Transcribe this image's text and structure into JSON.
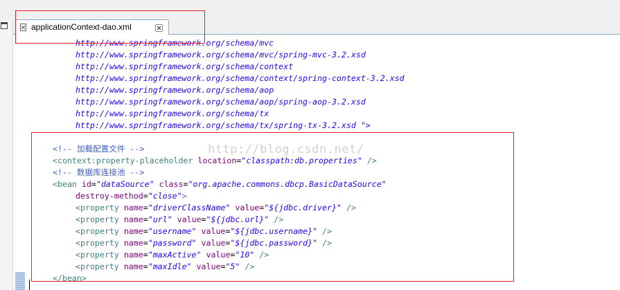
{
  "tab": {
    "label": "applicationContext-dao.xml"
  },
  "urls": [
    "http://www.springframework.org/schema/mvc",
    "http://www.springframework.org/schema/mvc/spring-mvc-3.2.xsd",
    "http://www.springframework.org/schema/context",
    "http://www.springframework.org/schema/context/spring-context-3.2.xsd",
    "http://www.springframework.org/schema/aop",
    "http://www.springframework.org/schema/aop/spring-aop-3.2.xsd",
    "http://www.springframework.org/schema/tx",
    "http://www.springframework.org/schema/tx/spring-tx-3.2.xsd"
  ],
  "url_end": " \">",
  "code": {
    "comment1": "<!-- 加载配置文件 -->",
    "placeholder_tag": "<context:property-placeholder",
    "placeholder_attr": "location",
    "placeholder_value": "\"classpath:db.properties\"",
    "placeholder_end": " />",
    "comment2": "<!-- 数据库连接池 -->",
    "bean_tag": "<bean",
    "bean_id_attr": "id",
    "bean_id_value": "\"dataSource\"",
    "bean_class_attr": "class",
    "bean_class_value": "\"org.apache.commons.dbcp.BasicDataSource\"",
    "destroy_attr": "destroy-method",
    "destroy_value": "\"close\"",
    "destroy_end": ">",
    "property_tag": "<property",
    "name_attr": "name",
    "value_attr": "value",
    "property_end": " />",
    "bean_close": "</bean>",
    "properties": [
      {
        "name": "\"driverClassName\"",
        "value": "\"${jdbc.driver}\""
      },
      {
        "name": "\"url\"",
        "value": "\"${jdbc.url}\""
      },
      {
        "name": "\"username\"",
        "value": "\"${jdbc.username}\""
      },
      {
        "name": "\"password\"",
        "value": "\"${jdbc.password}\""
      },
      {
        "name": "\"maxActive\"",
        "value": "\"10\""
      },
      {
        "name": "\"maxIdle\"",
        "value": "\"5\""
      }
    ]
  },
  "watermark": "http://blog.csdn.net/",
  "colors": {
    "tag": "#3f7f7f",
    "attribute": "#7f007f",
    "string": "#2a00ff",
    "comment": "#3f5fbf",
    "highlight": "#e02020"
  }
}
